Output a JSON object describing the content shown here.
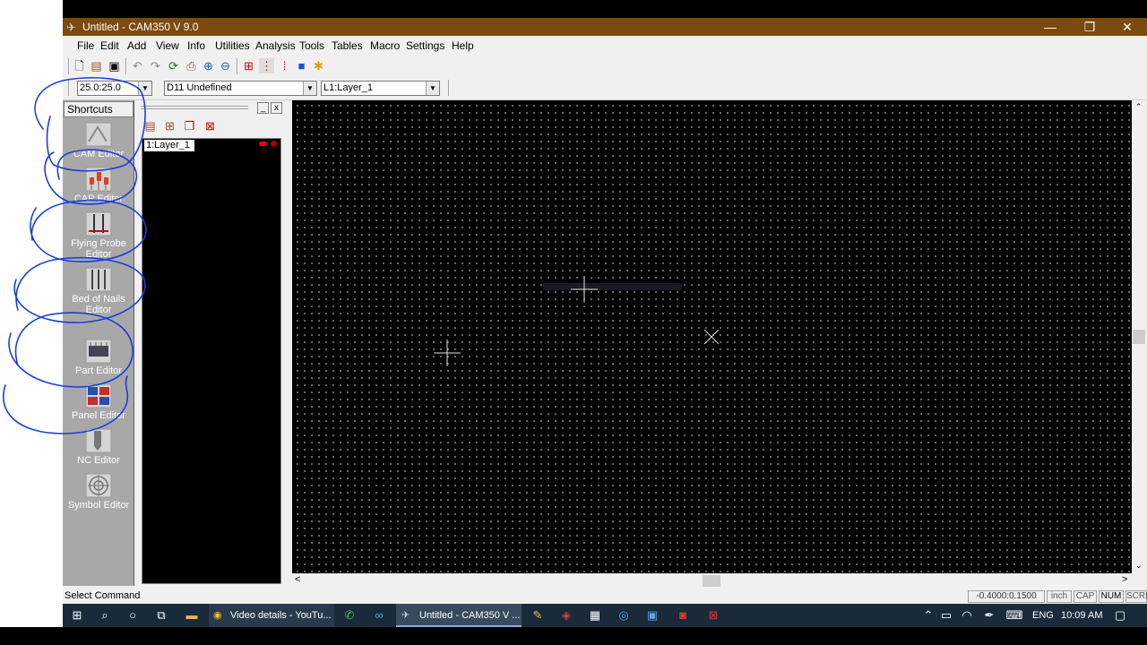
{
  "window": {
    "title": "Untitled - CAM350 V 9.0",
    "minimize": "—",
    "restore": "❐",
    "close": "✕"
  },
  "menu": [
    "File",
    "Edit",
    "Add",
    "View",
    "Info",
    "Utilities",
    "Analysis",
    "Tools",
    "Tables",
    "Macro",
    "Settings",
    "Help"
  ],
  "combos": {
    "grid": "25.0:25.0",
    "dcode": "D11  Undefined",
    "layer": "L1:Layer_1"
  },
  "shortcuts": {
    "header": "Shortcuts",
    "items": [
      {
        "label": "CAM Editor",
        "icon": "cam-editor-icon"
      },
      {
        "label": "CAP Editor",
        "icon": "cap-editor-icon"
      },
      {
        "label": "Flying Probe Editor",
        "icon": "flying-probe-icon"
      },
      {
        "label": "Bed of Nails Editor",
        "icon": "bed-of-nails-icon"
      },
      {
        "label": "Part Editor",
        "icon": "part-editor-icon"
      },
      {
        "label": "Panel Editor",
        "icon": "panel-editor-icon"
      },
      {
        "label": "NC Editor",
        "icon": "nc-editor-icon"
      },
      {
        "label": "Symbol Editor",
        "icon": "symbol-editor-icon"
      }
    ]
  },
  "layers": {
    "entry": "1:Layer_1",
    "panel_min": "_",
    "panel_close": "x"
  },
  "status": {
    "command": "Select Command",
    "coords": "-0.4000:0.1500",
    "units": "inch",
    "cap": "CAP",
    "num": "NUM",
    "scrl": "SCRL"
  },
  "taskbar": {
    "chrome_label": "Video details - YouTu...",
    "cam_label": "Untitled - CAM350 V ...",
    "lang": "ENG",
    "time": "10:09 AM"
  },
  "colors": {
    "titlebar": "#7a4a0e",
    "canvas": "#000000",
    "grid_dot": "#8a8a8a",
    "ink": "#1a3fd6"
  }
}
